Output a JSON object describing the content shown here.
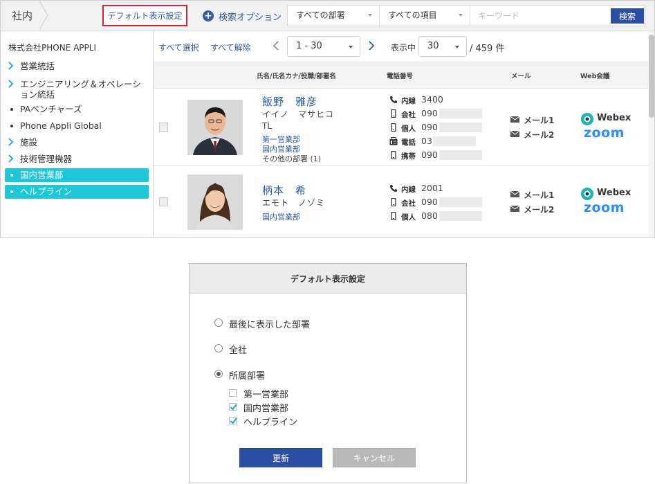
{
  "header": {
    "breadcrumb": "社内",
    "default_display_label": "デフォルト表示設定",
    "search_option_label": "検索オプション",
    "department_select": "すべての部署",
    "item_select": "すべての項目",
    "keyword_placeholder": "キーワード",
    "search_button": "検索"
  },
  "sidebar": {
    "company": "株式会社PHONE APPLI",
    "items": [
      {
        "label": "営業統括",
        "marker": "chevron-right-icon",
        "active": false
      },
      {
        "label": "エンジニアリング＆オペレーション統括",
        "marker": "chevron-right-icon",
        "active": false
      },
      {
        "label": "PAベンチャーズ",
        "marker": "bullet",
        "active": false
      },
      {
        "label": "Phone Appli Global",
        "marker": "bullet",
        "active": false
      },
      {
        "label": "施設",
        "marker": "chevron-right-icon",
        "active": false
      },
      {
        "label": "技術管理機器",
        "marker": "chevron-right-icon",
        "active": false
      },
      {
        "label": "国内営業部",
        "marker": "bullet",
        "active": true
      },
      {
        "label": "ヘルプライン",
        "marker": "bullet",
        "active": true
      }
    ],
    "active_color": "#1dc7d8"
  },
  "toolbar": {
    "select_all": "すべて選択",
    "deselect_all": "すべて解除",
    "range": "1 - 30",
    "display_label": "表示中",
    "per_page": "30",
    "total": "/ 459 件"
  },
  "table": {
    "headers": {
      "name": "氏名/氏名カナ/役職/部署名",
      "phone": "電話番号",
      "mail": "メール",
      "web": "Web会議"
    },
    "rows": [
      {
        "name": "飯野　雅彦",
        "kana": "イイノ　マサヒコ",
        "title": "TL",
        "departments": [
          "第一営業部",
          "国内営業部"
        ],
        "other": "その他の部署 (1)",
        "phones": [
          {
            "icon": "phone-icon",
            "label": "内線",
            "number": "3400"
          },
          {
            "icon": "mobile-icon",
            "label": "会社",
            "number": "090"
          },
          {
            "icon": "mobile-icon",
            "label": "個人",
            "number": "090"
          },
          {
            "icon": "fax-icon",
            "label": "電話",
            "number": "03"
          },
          {
            "icon": "mobile-icon",
            "label": "携帯",
            "number": "090"
          }
        ],
        "mails": [
          "メール1",
          "メール2"
        ],
        "webex": "Webex",
        "zoom": "zoom"
      },
      {
        "name": "柄本　希",
        "kana": "エモト　ノゾミ",
        "title": "",
        "departments": [
          "国内営業部"
        ],
        "other": "",
        "phones": [
          {
            "icon": "phone-icon",
            "label": "内線",
            "number": "2001"
          },
          {
            "icon": "mobile-icon",
            "label": "会社",
            "number": "090"
          },
          {
            "icon": "mobile-icon",
            "label": "個人",
            "number": "080"
          }
        ],
        "mails": [
          "メール1",
          "メール2"
        ],
        "webex": "Webex",
        "zoom": "zoom"
      }
    ]
  },
  "dialog": {
    "title": "デフォルト表示設定",
    "options": [
      {
        "label": "最後に表示した部署",
        "checked": false
      },
      {
        "label": "全社",
        "checked": false
      },
      {
        "label": "所属部署",
        "checked": true
      }
    ],
    "departments": [
      {
        "label": "第一営業部",
        "checked": false
      },
      {
        "label": "国内営業部",
        "checked": true
      },
      {
        "label": "ヘルプライン",
        "checked": true
      }
    ],
    "update_button": "更新",
    "cancel_button": "キャンセル"
  },
  "colors": {
    "link": "#2f5d9e",
    "primary_button": "#2c4ea3",
    "highlight_border": "#d6213b",
    "zoom_blue": "#2d8cff"
  }
}
